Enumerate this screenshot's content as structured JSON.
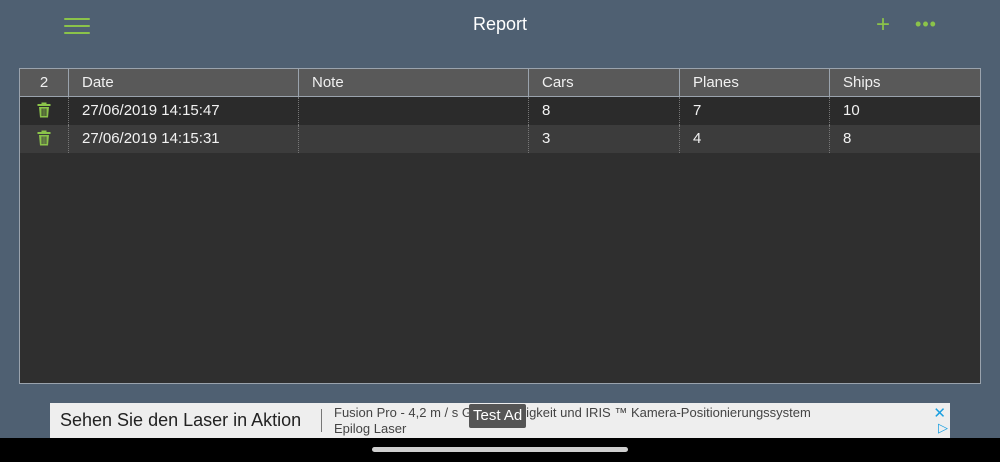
{
  "topbar": {
    "title": "Report",
    "menu_icon": "hamburger-icon",
    "add_label": "+",
    "more_label": "•••",
    "accent": "#8bc34a",
    "background": "#4f6072"
  },
  "table": {
    "header": {
      "count": "2",
      "date": "Date",
      "note": "Note",
      "cars": "Cars",
      "planes": "Planes",
      "ships": "Ships"
    },
    "rows": [
      {
        "icon": "trash-icon",
        "date": "27/06/2019 14:15:47",
        "note": "",
        "cars": "8",
        "planes": "7",
        "ships": "10"
      },
      {
        "icon": "trash-icon",
        "date": "27/06/2019 14:15:31",
        "note": "",
        "cars": "3",
        "planes": "4",
        "ships": "8"
      }
    ]
  },
  "ad": {
    "headline": "Sehen Sie den Laser in Aktion",
    "line1": "Fusion Pro - 4,2 m / s Geschwindigkeit und IRIS ™ Kamera-Positionierungssystem",
    "line2": "Epilog Laser",
    "label": "Test Ad",
    "close_label": "✕",
    "choices_label": "▷"
  }
}
